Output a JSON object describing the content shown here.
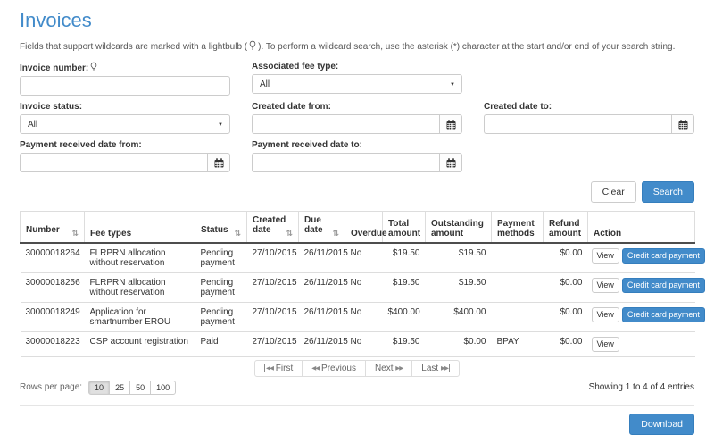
{
  "page": {
    "title": "Invoices",
    "desc_prefix": "Fields that support wildcards are marked with a lightbulb (",
    "desc_suffix": "). To perform a wildcard search, use the asterisk (*) character at the start and/or end of your search string."
  },
  "icons": {
    "sort": "⇅",
    "caret": "▼",
    "backward": "◀◀",
    "forward": "▶▶"
  },
  "search_form": {
    "invoice_number_label": "Invoice number:",
    "invoice_number_value": "",
    "associated_fee_type_label": "Associated fee type:",
    "associated_fee_type_value": "All",
    "invoice_status_label": "Invoice status:",
    "invoice_status_value": "All",
    "created_date_from_label": "Created date from:",
    "created_date_from_value": "",
    "created_date_to_label": "Created date to:",
    "created_date_to_value": "",
    "payment_received_date_from_label": "Payment received date from:",
    "payment_received_date_from_value": "",
    "payment_received_date_to_label": "Payment received date to:",
    "payment_received_date_to_value": "",
    "clear_button": "Clear",
    "search_button": "Search"
  },
  "table": {
    "columns": [
      {
        "label": "Number",
        "sortable": true
      },
      {
        "label": "Fee types",
        "sortable": false
      },
      {
        "label": "Status",
        "sortable": true
      },
      {
        "label": "Created date",
        "sortable": true
      },
      {
        "label": "Due date",
        "sortable": true
      },
      {
        "label": "Overdue",
        "sortable": false
      },
      {
        "label": "Total amount",
        "sortable": false
      },
      {
        "label": "Outstanding amount",
        "sortable": false
      },
      {
        "label": "Payment methods",
        "sortable": false
      },
      {
        "label": "Refund amount",
        "sortable": false
      },
      {
        "label": "Action",
        "sortable": false
      }
    ],
    "rows": [
      {
        "number": "30000018264",
        "fee_types": "FLRPRN allocation without reservation",
        "status": "Pending payment",
        "created_date": "27/10/2015",
        "due_date": "26/11/2015",
        "overdue": "No",
        "total_amount": "$19.50",
        "outstanding_amount": "$19.50",
        "payment_methods": "",
        "refund_amount": "$0.00",
        "actions": [
          "View",
          "Credit card payment"
        ]
      },
      {
        "number": "30000018256",
        "fee_types": "FLRPRN allocation without reservation",
        "status": "Pending payment",
        "created_date": "27/10/2015",
        "due_date": "26/11/2015",
        "overdue": "No",
        "total_amount": "$19.50",
        "outstanding_amount": "$19.50",
        "payment_methods": "",
        "refund_amount": "$0.00",
        "actions": [
          "View",
          "Credit card payment"
        ]
      },
      {
        "number": "30000018249",
        "fee_types": "Application for smartnumber EROU",
        "status": "Pending payment",
        "created_date": "27/10/2015",
        "due_date": "26/11/2015",
        "overdue": "No",
        "total_amount": "$400.00",
        "outstanding_amount": "$400.00",
        "payment_methods": "",
        "refund_amount": "$0.00",
        "actions": [
          "View",
          "Credit card payment"
        ]
      },
      {
        "number": "30000018223",
        "fee_types": "CSP account registration",
        "status": "Paid",
        "created_date": "27/10/2015",
        "due_date": "26/11/2015",
        "overdue": "No",
        "total_amount": "$19.50",
        "outstanding_amount": "$0.00",
        "payment_methods": "BPAY",
        "refund_amount": "$0.00",
        "actions": [
          "View"
        ]
      }
    ]
  },
  "pagination": {
    "first": "First",
    "previous": "Previous",
    "next": "Next",
    "last": "Last"
  },
  "rows_per_page": {
    "label": "Rows per page:",
    "options": [
      "10",
      "25",
      "50",
      "100"
    ],
    "selected": "10"
  },
  "summary": "Showing 1 to 4 of 4 entries",
  "download_button": "Download",
  "colors": {
    "primary": "#428bca",
    "primary_border": "#357ebd",
    "title": "#428bca",
    "header_rule": "#4d4d4d",
    "row_border": "#dddddd"
  }
}
